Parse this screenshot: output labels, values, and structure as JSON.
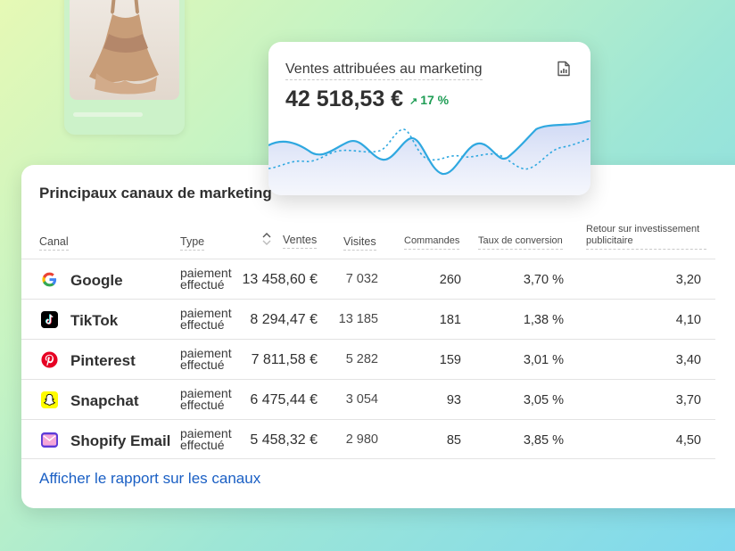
{
  "marketing_card": {
    "title": "Ventes attribuées au marketing",
    "value": "42 518,53 €",
    "change_arrow": "↗",
    "change": "17 %",
    "report_icon": "report-icon"
  },
  "channels": {
    "title": "Principaux canaux de marketing",
    "headers": {
      "channel": "Canal",
      "type": "Type",
      "sales": "Ventes",
      "visits": "Visites",
      "orders": "Commandes",
      "conversion": "Taux de conversion",
      "roas_line1": "Retour sur investissement",
      "roas_line2": "publicitaire"
    },
    "rows": [
      {
        "name": "Google",
        "icon": "google-icon",
        "type_line1": "paiement",
        "type_line2": "effectué",
        "sales": "13 458,60 €",
        "visits": "7 032",
        "orders": "260",
        "conversion": "3,70 %",
        "roas": "3,20"
      },
      {
        "name": "TikTok",
        "icon": "tiktok-icon",
        "type_line1": "paiement",
        "type_line2": "effectué",
        "sales": "8 294,47 €",
        "visits": "13 185",
        "orders": "181",
        "conversion": "1,38 %",
        "roas": "4,10"
      },
      {
        "name": "Pinterest",
        "icon": "pinterest-icon",
        "type_line1": "paiement",
        "type_line2": "effectué",
        "sales": "7 811,58 €",
        "visits": "5 282",
        "orders": "159",
        "conversion": "3,01 %",
        "roas": "3,40"
      },
      {
        "name": "Snapchat",
        "icon": "snapchat-icon",
        "type_line1": "paiement",
        "type_line2": "effectué",
        "sales": "6 475,44 €",
        "visits": "3 054",
        "orders": "93",
        "conversion": "3,05 %",
        "roas": "3,70"
      },
      {
        "name": "Shopify Email",
        "icon": "shopify-email-icon",
        "type_line1": "paiement",
        "type_line2": "effectué",
        "sales": "5 458,32 €",
        "visits": "2 980",
        "orders": "85",
        "conversion": "3,85 %",
        "roas": "4,50"
      }
    ],
    "report_link": "Afficher le rapport sur les canaux"
  },
  "colors": {
    "accent_link": "#1a5fc4",
    "positive": "#1f9d55",
    "chart_line": "#2fa8e0"
  }
}
